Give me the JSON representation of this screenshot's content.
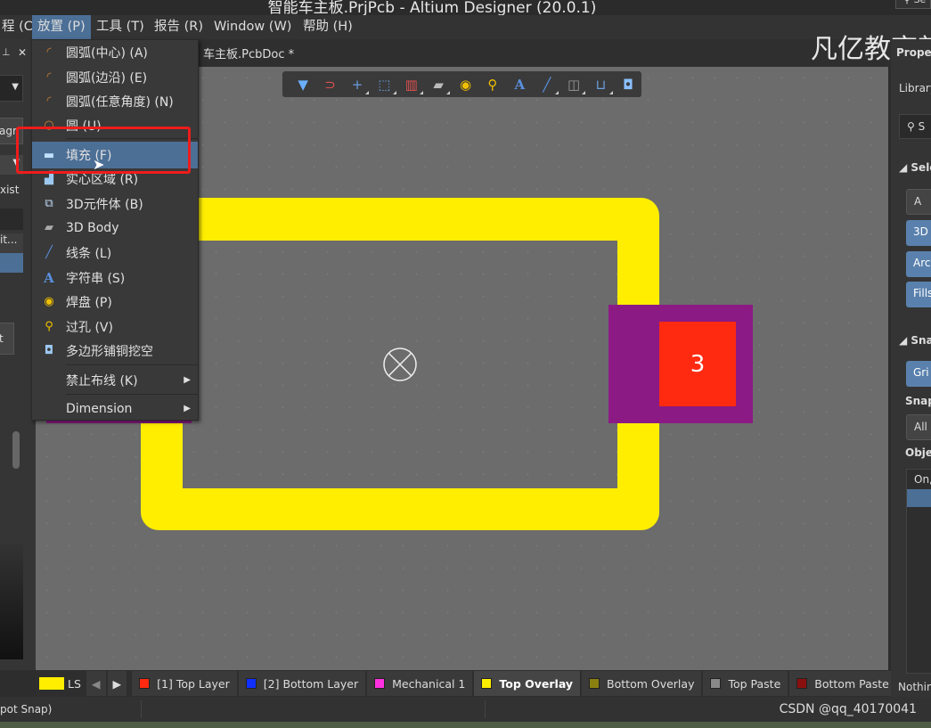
{
  "window": {
    "title": "智能车主板.PrjPcb - Altium Designer (20.0.1)",
    "search_placeholder": "Se"
  },
  "menubar": {
    "items": [
      "程 (C)",
      "放置 (P)",
      "工具 (T)",
      "报告 (R)",
      "Window (W)",
      "帮助 (H)"
    ],
    "active": "放置 (P)"
  },
  "document_tab": "车主板.PcbDoc *",
  "watermark": "凡亿教育新",
  "left_panel": {
    "texts": [
      "agr",
      "xist",
      "it...",
      "t"
    ]
  },
  "place_menu": {
    "items": [
      {
        "label": "圆弧(中心) (A)",
        "icon": "arc-center-icon"
      },
      {
        "label": "圆弧(边沿) (E)",
        "icon": "arc-edge-icon"
      },
      {
        "label": "圆弧(任意角度) (N)",
        "icon": "arc-any-angle-icon"
      },
      {
        "label": "圆 (U)",
        "icon": "circle-icon"
      },
      {
        "label": "填充 (F)",
        "icon": "fill-icon",
        "highlighted": true
      },
      {
        "label": "实心区域 (R)",
        "icon": "solid-region-icon"
      },
      {
        "label": "3D元件体 (B)",
        "icon": "3d-component-body-icon"
      },
      {
        "label": "3D Body",
        "icon": "3d-body-icon"
      },
      {
        "label": "线条 (L)",
        "icon": "line-icon"
      },
      {
        "label": "字符串 (S)",
        "icon": "string-icon"
      },
      {
        "label": "焊盘 (P)",
        "icon": "pad-icon"
      },
      {
        "label": "过孔 (V)",
        "icon": "via-icon"
      },
      {
        "label": "多边形铺铜挖空",
        "icon": "polygon-cutout-icon"
      },
      {
        "label": "禁止布线 (K)",
        "submenu": true
      },
      {
        "label": "Dimension",
        "submenu": true
      }
    ]
  },
  "toolbar": {
    "icons": [
      "filter-icon",
      "snap-magnet-icon",
      "cross-add-icon",
      "select-rect-icon",
      "align-icon",
      "component-icon",
      "pad-icon",
      "via-icon",
      "text-icon",
      "line-icon",
      "dimension-icon",
      "room-icon",
      "polygon-icon"
    ]
  },
  "pcb": {
    "pad_label": "3",
    "colors": {
      "outline": "#ffee00",
      "pad": "#ff2a10",
      "solder_mask": "#8b1a85",
      "canvas": "#6c6c6c"
    }
  },
  "layer_tabs": {
    "current_color": "#ffee00",
    "ls": "LS",
    "tabs": [
      {
        "label": "[1] Top Layer",
        "color": "#ff2a10"
      },
      {
        "label": "[2] Bottom Layer",
        "color": "#1030ff"
      },
      {
        "label": "Mechanical 1",
        "color": "#ff30e0"
      },
      {
        "label": "Top Overlay",
        "color": "#ffee00",
        "active": true
      },
      {
        "label": "Bottom Overlay",
        "color": "#8a8010"
      },
      {
        "label": "Top Paste",
        "color": "#888888"
      },
      {
        "label": "Bottom Paste",
        "color": "#8a1010"
      },
      {
        "label": "",
        "color": "#a020a0"
      }
    ]
  },
  "status": {
    "left": "pot Snap)",
    "right": "CSDN @qq_40170041"
  },
  "right_panel": {
    "title": "Prope",
    "library": "Library",
    "search": "S",
    "section_select": "Sele",
    "buttons": [
      "A",
      "3D",
      "Arc",
      "Fills"
    ],
    "section_snap": "Snap",
    "grid_button": "Gri",
    "snap_label": "Snap",
    "all_button": "All",
    "objects_label": "Obje",
    "on_label": "On,",
    "nothing": "Nothin"
  }
}
